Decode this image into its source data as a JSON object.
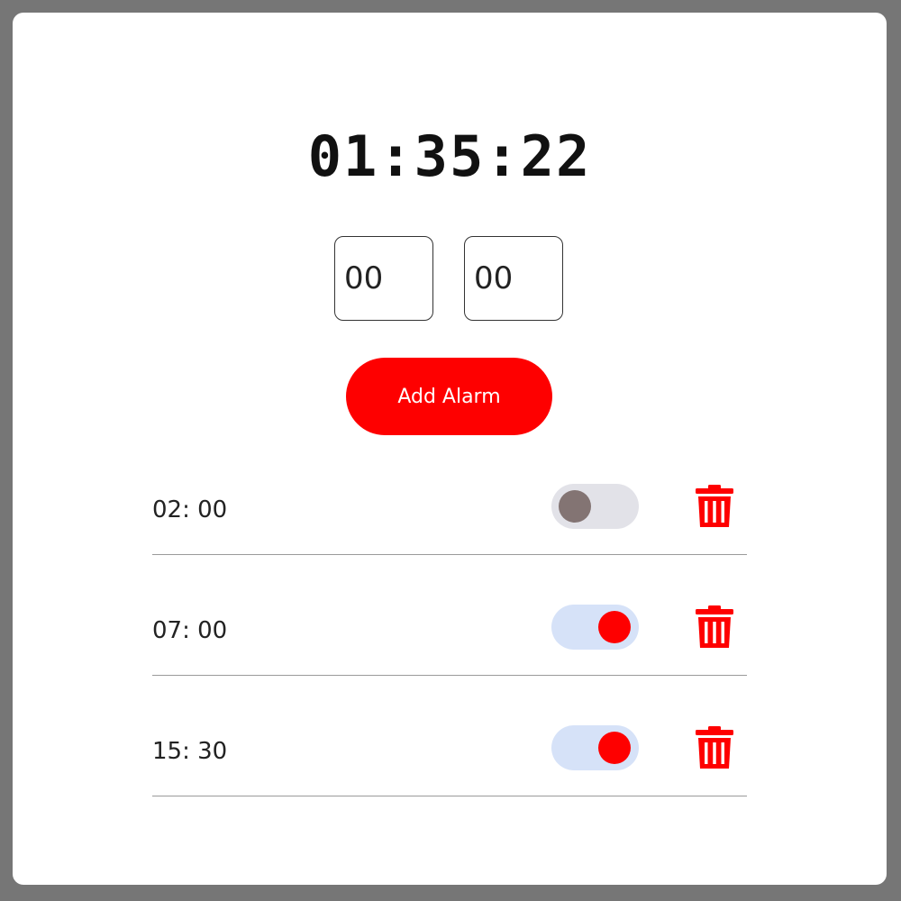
{
  "clock": {
    "time": "01:35:22"
  },
  "inputs": {
    "hours_value": "00",
    "minutes_value": "00"
  },
  "actions": {
    "add_label": "Add Alarm"
  },
  "alarms": [
    {
      "time": "02: 00",
      "enabled": false
    },
    {
      "time": "07: 00",
      "enabled": true
    },
    {
      "time": "15: 30",
      "enabled": true
    }
  ],
  "colors": {
    "accent": "#fe0000",
    "toggle_on_track": "#d6e2f8",
    "toggle_off_track": "#e2e2e8",
    "toggle_off_knob": "#837473",
    "background": "#767676"
  }
}
